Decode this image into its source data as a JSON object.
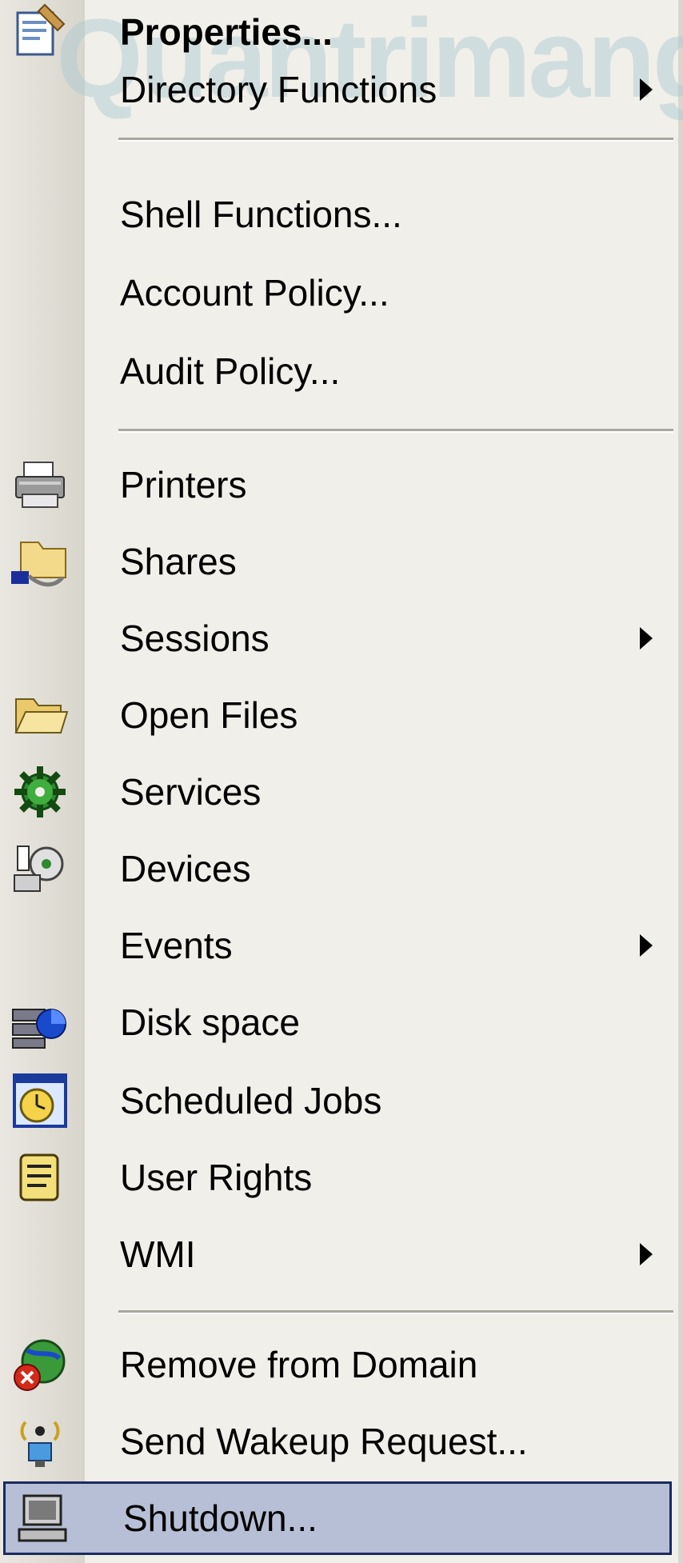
{
  "watermark": "Quantrimang",
  "menu": {
    "items": [
      {
        "label": "Properties...",
        "icon": "properties-icon",
        "bold": true
      },
      {
        "label": "Directory Functions",
        "submenu": true
      },
      {
        "label": "Shell Functions..."
      },
      {
        "label": "Account Policy..."
      },
      {
        "label": "Audit Policy..."
      },
      {
        "label": "Printers",
        "icon": "printer-icon"
      },
      {
        "label": "Shares",
        "icon": "shared-folder-icon"
      },
      {
        "label": "Sessions",
        "submenu": true
      },
      {
        "label": "Open Files",
        "icon": "open-folder-icon"
      },
      {
        "label": "Services",
        "icon": "gear-services-icon"
      },
      {
        "label": "Devices",
        "icon": "devices-icon"
      },
      {
        "label": "Events",
        "submenu": true
      },
      {
        "label": "Disk space",
        "icon": "disk-space-icon"
      },
      {
        "label": "Scheduled Jobs",
        "icon": "scheduled-clock-icon"
      },
      {
        "label": "User Rights",
        "icon": "scroll-rights-icon"
      },
      {
        "label": "WMI",
        "submenu": true
      },
      {
        "label": "Remove from Domain",
        "icon": "remove-domain-icon"
      },
      {
        "label": "Send Wakeup Request...",
        "icon": "wakeup-antenna-icon"
      },
      {
        "label": "Shutdown...",
        "icon": "computer-shutdown-icon",
        "selected": true
      }
    ]
  },
  "colors": {
    "background": "#f1efe9",
    "gutter": "#d8d5cc",
    "selection": "#b7bfd6",
    "selection_border": "#1c2a5e",
    "separator": "#a9a69e"
  }
}
